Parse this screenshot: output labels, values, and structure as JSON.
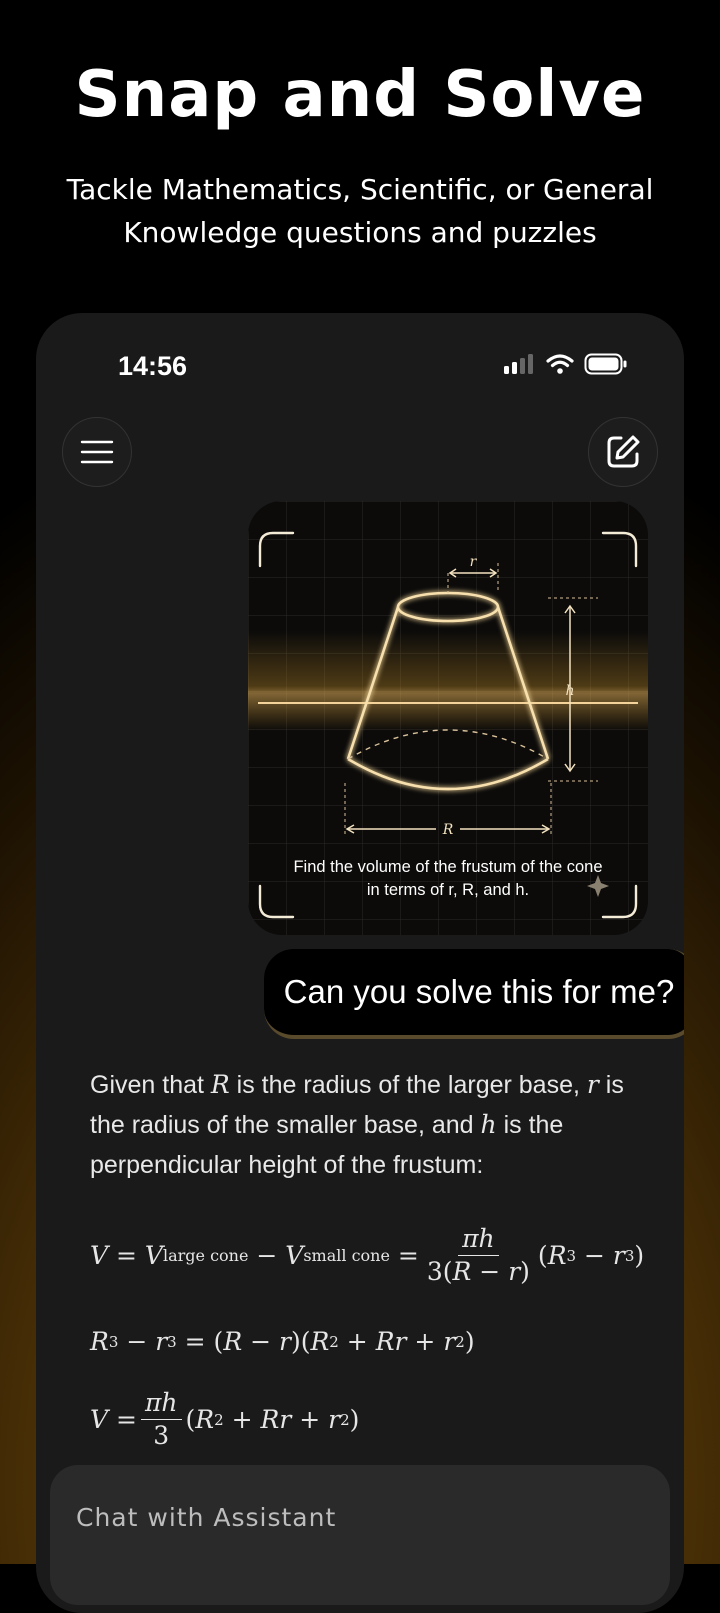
{
  "headline": "Snap and Solve",
  "subline": "Tackle Mathematics, Scientific, or General Knowledge questions and puzzles",
  "phone": {
    "status_bar": {
      "time": "14:56"
    },
    "header": {
      "menu_icon": "hamburger-menu-icon",
      "edit_icon": "new-chat-edit-icon"
    },
    "image_card": {
      "label_r": "r",
      "label_h": "h",
      "label_R": "R",
      "problem_line1": "Find the volume of the frustum of the cone",
      "problem_line2": "in terms of r, R, and h."
    },
    "user_message": "Can you solve this for me?",
    "answer_intro": {
      "p1": "Given that ",
      "var_R": "R",
      "p2": " is the radius of the larger base, ",
      "var_r": "r",
      "p3": " is the radius of the smaller base, and ",
      "var_h": "h",
      "p4": " is the perpendicular height of the frustum:"
    },
    "chat_input": {
      "placeholder": "Chat with Assistant"
    }
  },
  "colors": {
    "accent_gold": "#f5d89a",
    "bubble_border": "#5a4a2c",
    "phone_bg": "#1a1a1b"
  }
}
